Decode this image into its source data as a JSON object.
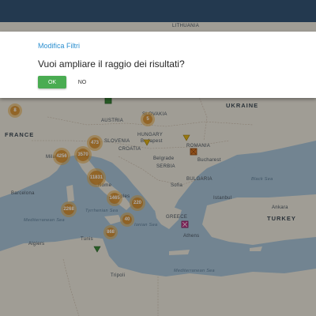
{
  "dialog": {
    "title": "Modifica Filtri",
    "message": "Vuoi ampliare il raggio dei risultati?",
    "ok_label": "OK",
    "no_label": "NO"
  },
  "map": {
    "countries": {
      "france": "FRANCE",
      "ukraine": "UKRAINE",
      "turkey": "TURKEY",
      "lithuania": "LITHUANIA",
      "hungary": "HUNGARY",
      "romania": "ROMANIA",
      "serbia": "SERBIA",
      "bulgaria": "BULGARIA",
      "greece": "GREECE",
      "slovakia": "SLOVAKIA",
      "austria": "AUSTRIA",
      "slovenia": "SLOVENIA",
      "croatia": "CROATIA"
    },
    "seas": {
      "tyrrhenian": "Tyrrhenian Sea",
      "mediterranean_west": "Mediterranean Sea",
      "mediterranean_east": "Mediterranean Sea",
      "ionian": "Ionian Sea",
      "black": "Black Sea"
    },
    "cities": {
      "milan": "Milan",
      "rome": "Rome",
      "naples": "Naples",
      "budapest": "Budapest",
      "bucharest": "Bucharest",
      "belgrade": "Belgrade",
      "sofia": "Sofia",
      "athens": "Athens",
      "istanbul": "Istanbul",
      "tunis": "Tunis",
      "algiers": "Algiers",
      "barcelona": "Barcelona",
      "tripoli": "Tripoli",
      "ankara": "Ankara"
    },
    "clusters": [
      {
        "count": "8"
      },
      {
        "count": "5"
      },
      {
        "count": "473"
      },
      {
        "count": "4256"
      },
      {
        "count": "3570"
      },
      {
        "count": "11831"
      },
      {
        "count": "1465"
      },
      {
        "count": "220"
      },
      {
        "count": "2268"
      },
      {
        "count": "40"
      },
      {
        "count": "868"
      }
    ],
    "colors": {
      "cluster": "#d68c28",
      "marker_green": "#3d8a3a",
      "marker_yellow": "#e0b21a",
      "marker_orange": "#d8782a",
      "marker_pink": "#c23a8a",
      "ok_button": "#4aac52",
      "title": "#2b8fd0",
      "topbar": "#23394f"
    }
  }
}
